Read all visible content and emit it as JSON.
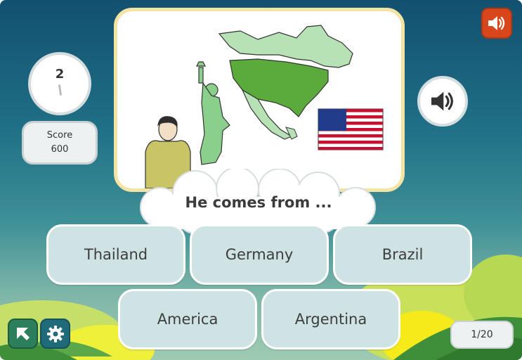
{
  "game": {
    "question": "He comes from ...",
    "timer_value": "2",
    "score_label": "Score",
    "score_value": "600",
    "progress": "1/20",
    "answers": [
      "Thailand",
      "Germany",
      "Brazil",
      "America",
      "Argentina"
    ]
  },
  "icons": {
    "sound_toggle": "speaker-icon",
    "audio_play": "speaker-icon",
    "exit": "exit-arrow-icon",
    "settings": "gear-icon"
  },
  "colors": {
    "answer_bg": "#cfe3e4",
    "card_border": "#f4e3a3",
    "sound_button": "#d9461c",
    "exit_button": "#2d7f5c",
    "settings_button": "#1f6b79"
  }
}
